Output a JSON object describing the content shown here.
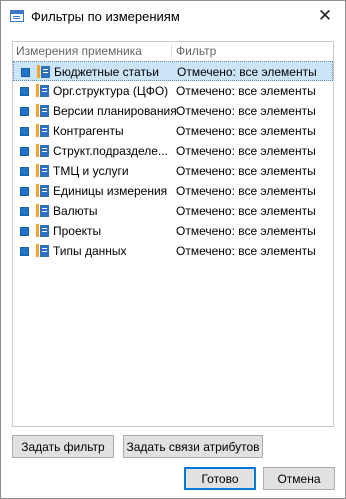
{
  "window": {
    "title": "Фильтры по измерениям",
    "close_glyph": "✕"
  },
  "grid": {
    "col_dimension": "Измерения приемника",
    "col_filter": "Фильтр",
    "rows": [
      {
        "name": "Бюджетные статьи",
        "filter": "Отмечено: все элементы",
        "checked": true,
        "selected": true
      },
      {
        "name": "Орг.структура (ЦФО)",
        "filter": "Отмечено: все элементы",
        "checked": true
      },
      {
        "name": "Версии планирования",
        "filter": "Отмечено: все элементы",
        "checked": true
      },
      {
        "name": "Контрагенты",
        "filter": "Отмечено: все элементы",
        "checked": true
      },
      {
        "name": "Структ.подразделе...",
        "filter": "Отмечено: все элементы",
        "checked": true
      },
      {
        "name": "ТМЦ и услуги",
        "filter": "Отмечено: все элементы",
        "checked": true
      },
      {
        "name": "Единицы измерения",
        "filter": "Отмечено: все элементы",
        "checked": true
      },
      {
        "name": "Валюты",
        "filter": "Отмечено: все элементы",
        "checked": true
      },
      {
        "name": "Проекты",
        "filter": "Отмечено: все элементы",
        "checked": true
      },
      {
        "name": "Типы данных",
        "filter": "Отмечено: все элементы",
        "checked": true
      }
    ]
  },
  "buttons": {
    "set_filter": "Задать фильтр",
    "set_attr_links": "Задать связи атрибутов",
    "ok": "Готово",
    "cancel": "Отмена"
  },
  "colors": {
    "accent": "#1f73c9",
    "selection": "#cce4f7"
  }
}
